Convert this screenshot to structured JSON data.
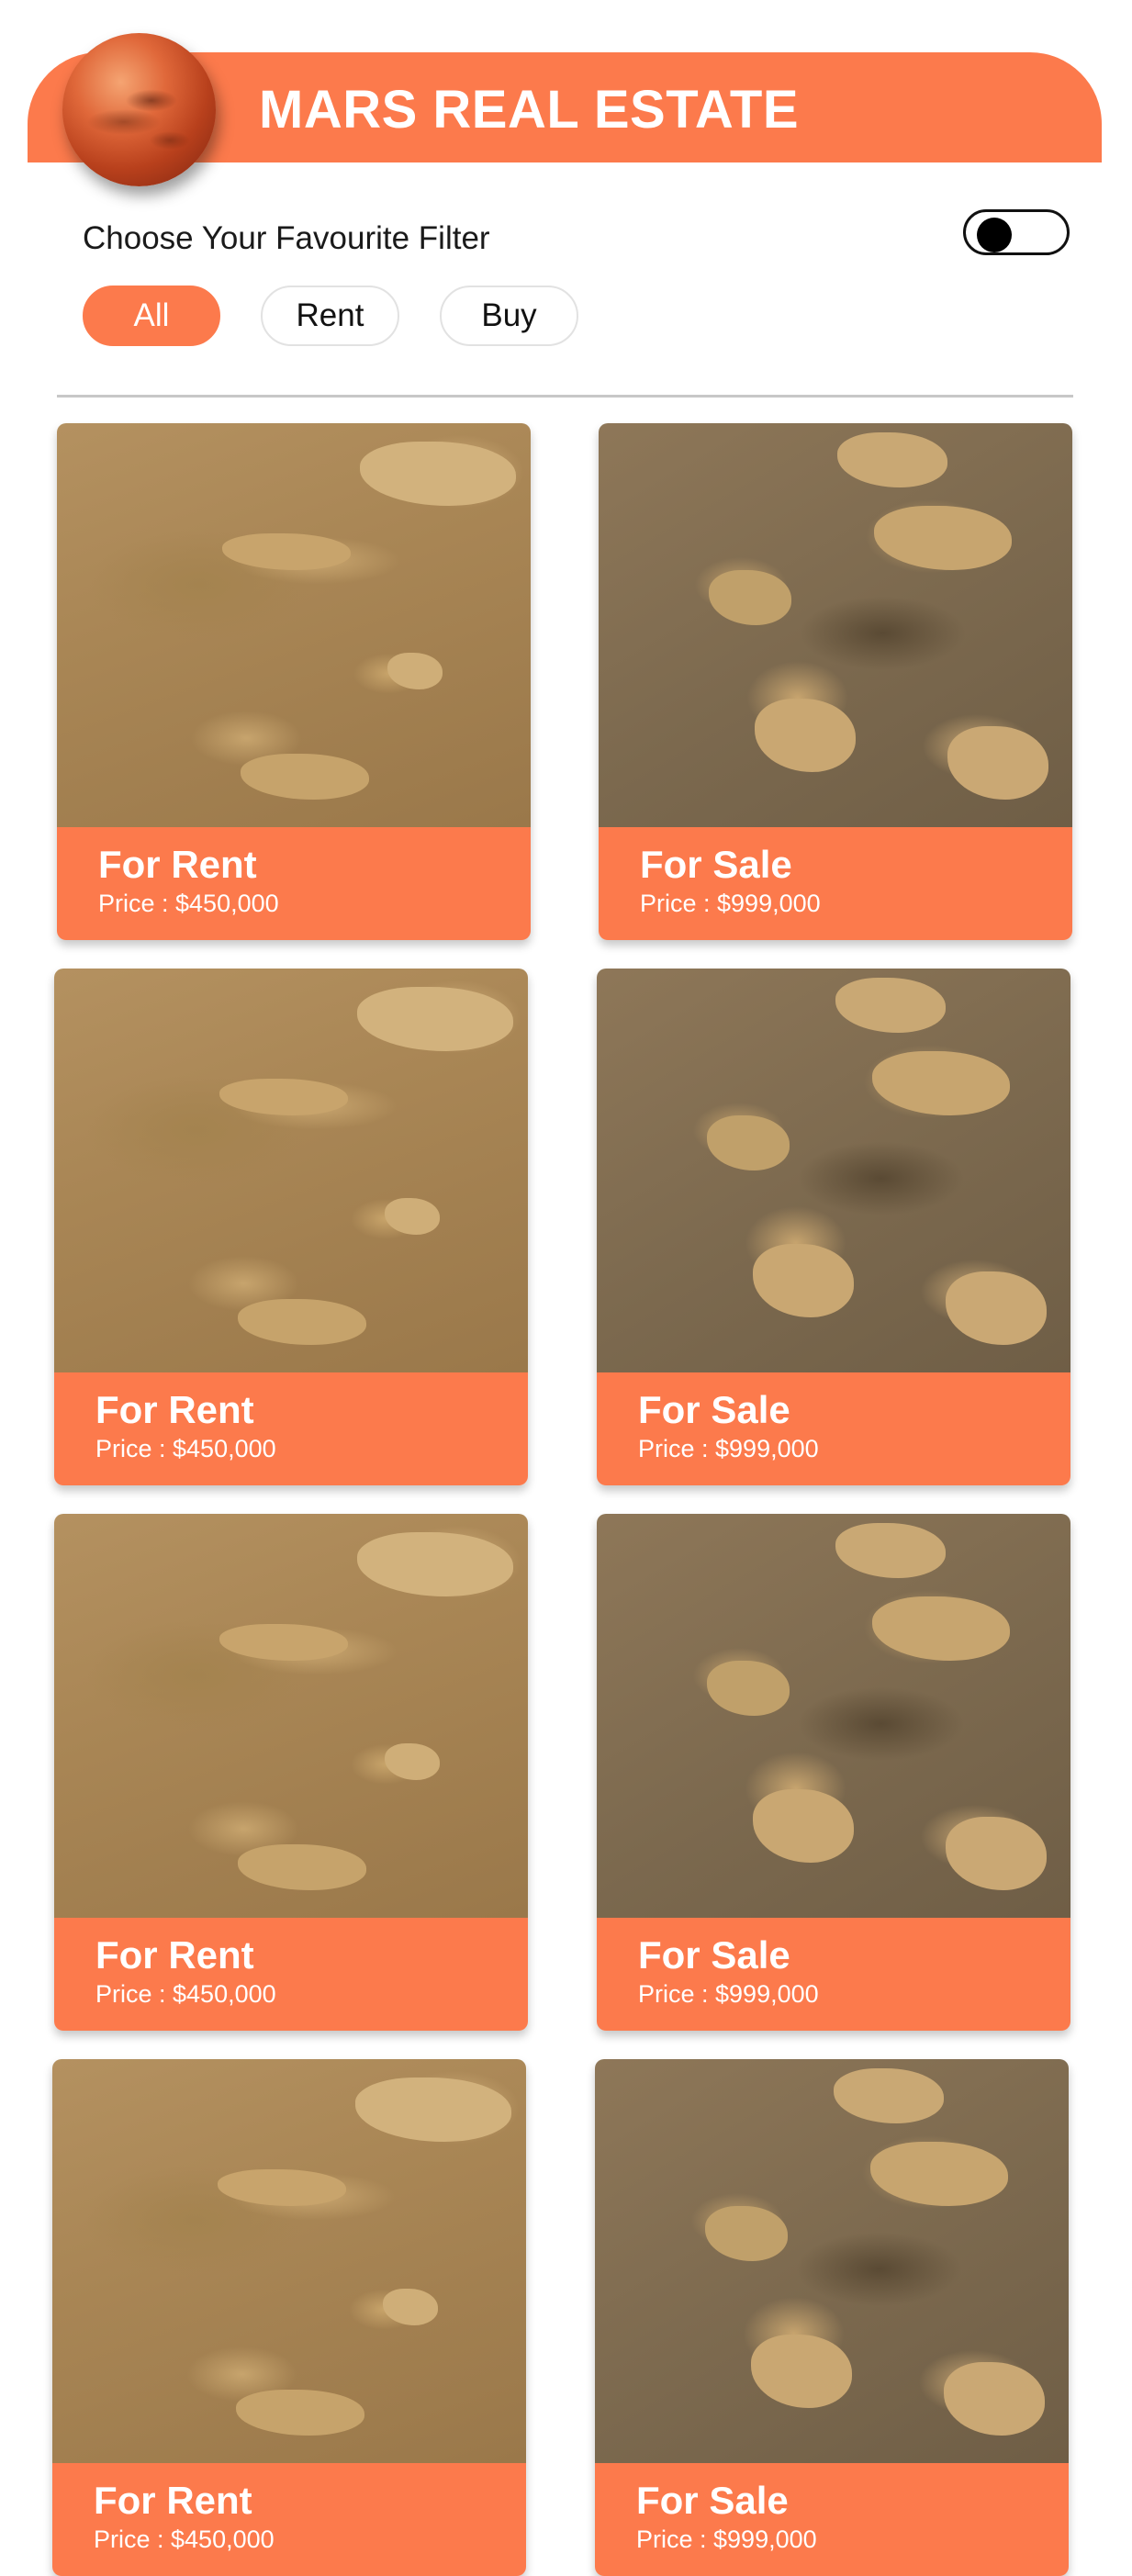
{
  "header": {
    "title": "MARS REAL ESTATE",
    "accent_color": "#fc7a4c",
    "logo_icon": "mars-planet-icon"
  },
  "filter": {
    "label": "Choose Your Favourite Filter",
    "toggle_state": "off",
    "options": [
      {
        "label": "All",
        "selected": true
      },
      {
        "label": "Rent",
        "selected": false
      },
      {
        "label": "Buy",
        "selected": false
      }
    ]
  },
  "listings": [
    {
      "title": "For Rent",
      "price": "Price : $450,000"
    },
    {
      "title": "For Sale",
      "price": "Price : $999,000"
    },
    {
      "title": "For Rent",
      "price": "Price : $450,000"
    },
    {
      "title": "For Sale",
      "price": "Price : $999,000"
    },
    {
      "title": "For Rent",
      "price": "Price : $450,000"
    },
    {
      "title": "For Sale",
      "price": "Price : $999,000"
    },
    {
      "title": "For Rent",
      "price": "Price : $450,000"
    },
    {
      "title": "For Sale",
      "price": "Price : $999,000"
    }
  ]
}
